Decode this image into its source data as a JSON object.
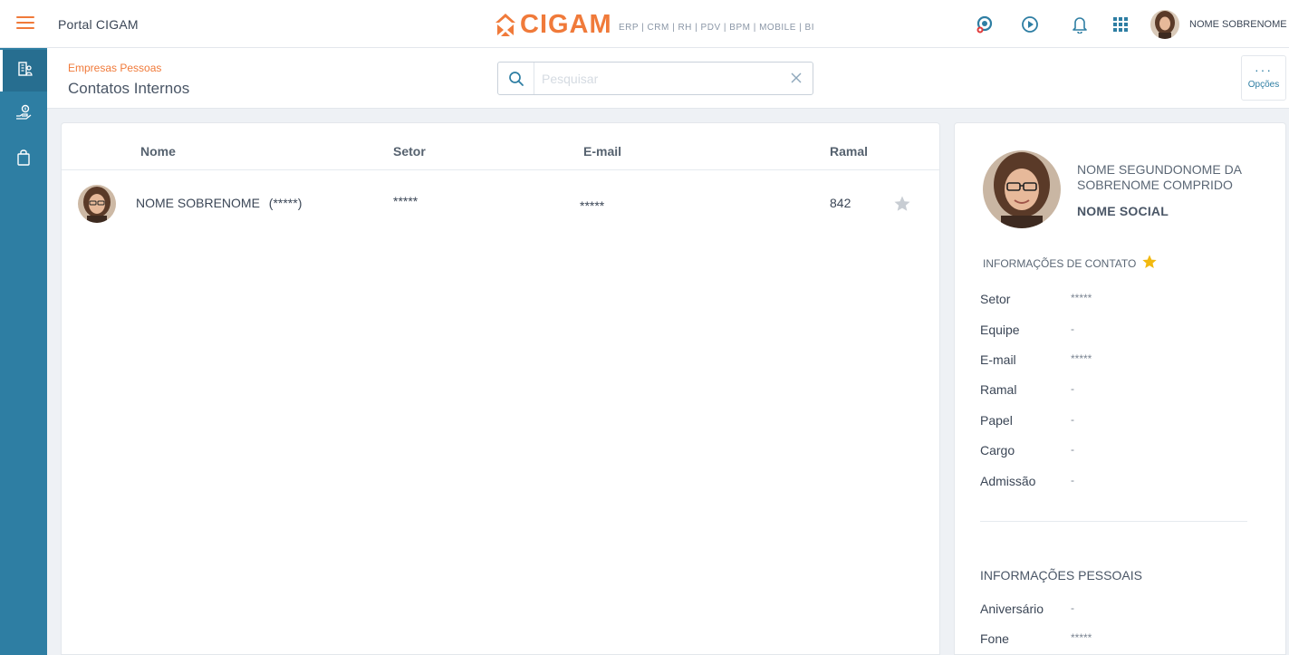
{
  "topbar": {
    "portal_title": "Portal CIGAM",
    "logo_text": "CIGAM",
    "tagline": "ERP | CRM | RH | PDV | BPM | MOBILE | BI",
    "user_name": "NOME SOBRENOME D...",
    "icons": [
      "hamburger-icon",
      "support-icon",
      "play-circle-icon",
      "bell-icon",
      "apps-grid-icon"
    ]
  },
  "sidebar": {
    "items": [
      {
        "icon": "building-icon",
        "active": true
      },
      {
        "icon": "hand-coin-icon",
        "active": false
      },
      {
        "icon": "bag-icon",
        "active": false
      }
    ]
  },
  "header": {
    "breadcrumb": "Empresas Pessoas",
    "title": "Contatos Internos",
    "search_placeholder": "Pesquisar",
    "options_label": "Opções"
  },
  "table": {
    "columns": [
      "Nome",
      "Setor",
      "E-mail",
      "Ramal"
    ],
    "rows": [
      {
        "name": "NOME SOBRENOME",
        "name_suffix": "(*****)",
        "setor": "*****",
        "email": "*****",
        "ramal": "842",
        "favorite": false
      }
    ]
  },
  "detail": {
    "full_name": "NOME SEGUNDONOME DA SOBRENOME COMPRIDO",
    "social_name": "NOME SOCIAL",
    "contact_section_title": "INFORMAÇÕES DE CONTATO",
    "contact_fields": [
      {
        "label": "Setor",
        "value": "*****"
      },
      {
        "label": "Equipe",
        "value": "-"
      },
      {
        "label": "E-mail",
        "value": "*****"
      },
      {
        "label": "Ramal",
        "value": "-"
      },
      {
        "label": "Papel",
        "value": "-"
      },
      {
        "label": "Cargo",
        "value": "-"
      },
      {
        "label": "Admissão",
        "value": "-"
      }
    ],
    "personal_section_title": "INFORMAÇÕES PESSOAIS",
    "personal_fields": [
      {
        "label": "Aniversário",
        "value": "-"
      },
      {
        "label": "Fone",
        "value": "*****"
      }
    ]
  },
  "colors": {
    "brand_orange": "#f07a3a",
    "sidebar_blue": "#2e7ea3",
    "star_gold": "#f2b90f",
    "star_gray": "#c8cdd3"
  }
}
